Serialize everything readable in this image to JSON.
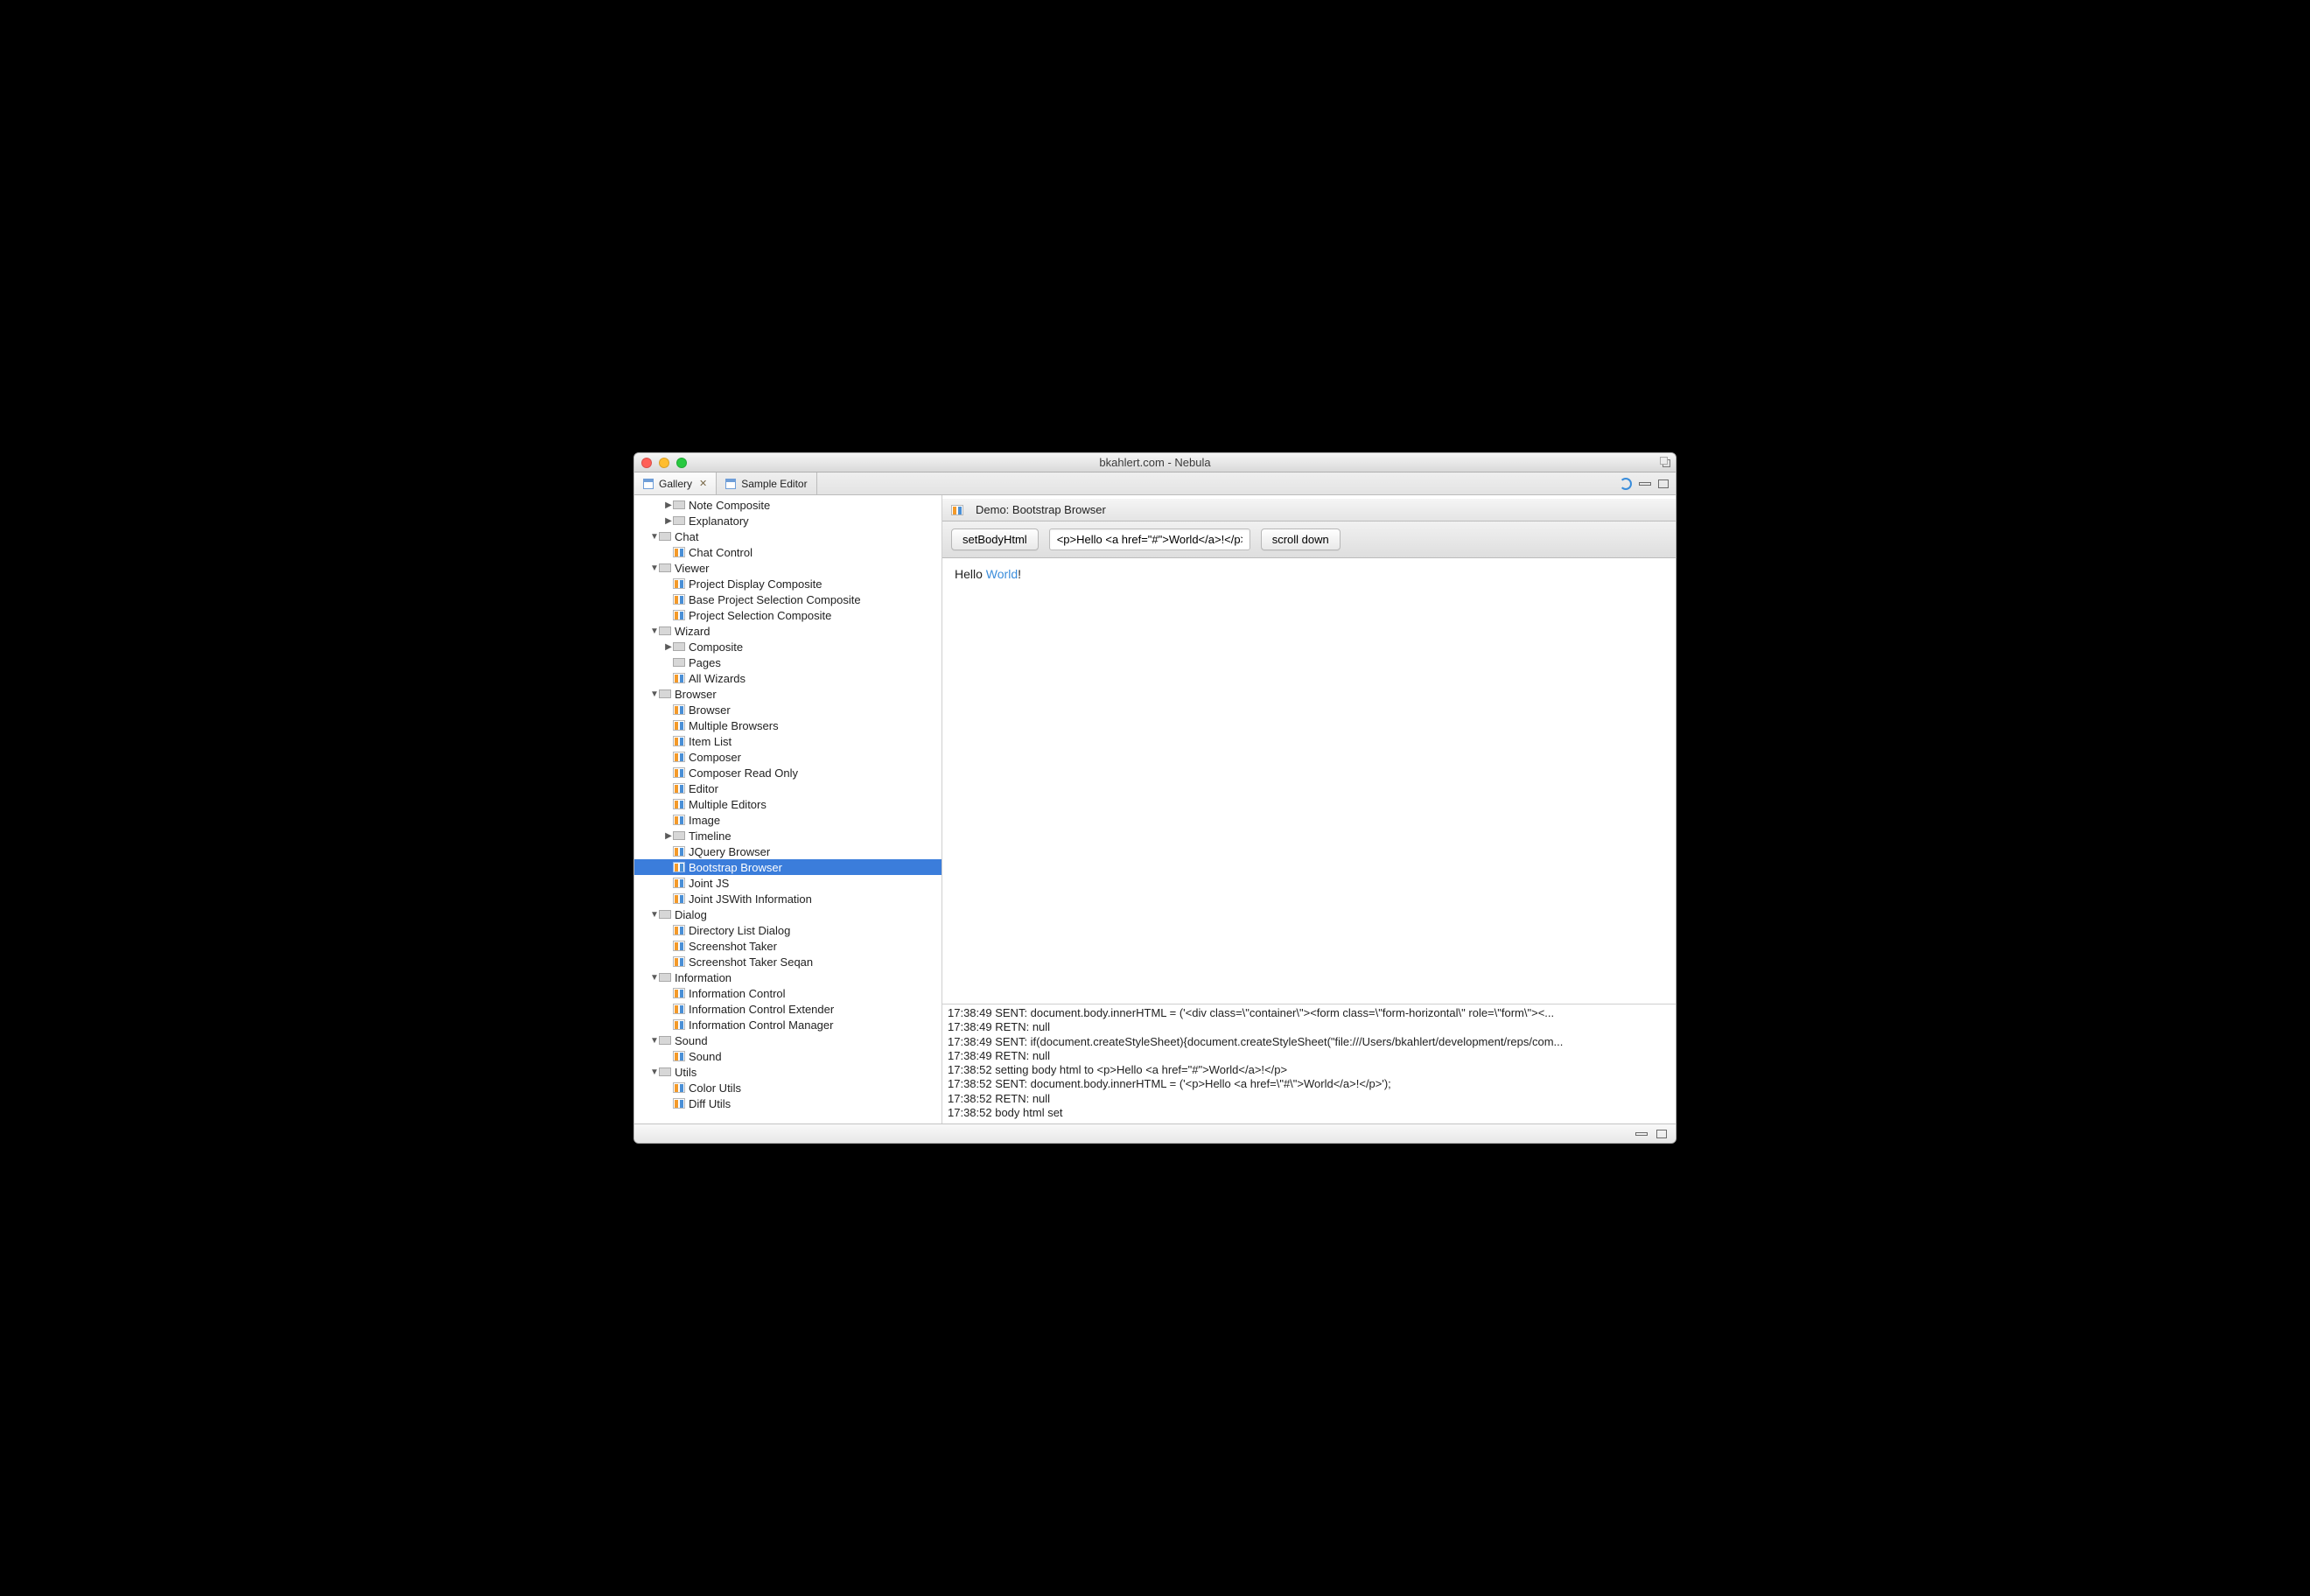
{
  "window": {
    "title": "bkahlert.com - Nebula"
  },
  "tabs": [
    {
      "label": "Gallery",
      "active": true,
      "closable": true
    },
    {
      "label": "Sample Editor",
      "active": false,
      "closable": false
    }
  ],
  "tree": [
    {
      "depth": 1,
      "arrow": "right",
      "icon": "folder",
      "label": "Note Composite"
    },
    {
      "depth": 1,
      "arrow": "right",
      "icon": "folder",
      "label": "Explanatory"
    },
    {
      "depth": 0,
      "arrow": "down",
      "icon": "folder",
      "label": "Chat"
    },
    {
      "depth": 1,
      "arrow": "",
      "icon": "page",
      "label": "Chat Control"
    },
    {
      "depth": 0,
      "arrow": "down",
      "icon": "folder",
      "label": "Viewer"
    },
    {
      "depth": 1,
      "arrow": "",
      "icon": "page",
      "label": "Project Display Composite"
    },
    {
      "depth": 1,
      "arrow": "",
      "icon": "page",
      "label": "Base Project Selection Composite"
    },
    {
      "depth": 1,
      "arrow": "",
      "icon": "page",
      "label": "Project Selection Composite"
    },
    {
      "depth": 0,
      "arrow": "down",
      "icon": "folder",
      "label": "Wizard"
    },
    {
      "depth": 1,
      "arrow": "right",
      "icon": "folder",
      "label": "Composite"
    },
    {
      "depth": 1,
      "arrow": "",
      "icon": "folder",
      "label": "Pages"
    },
    {
      "depth": 1,
      "arrow": "",
      "icon": "page",
      "label": "All Wizards"
    },
    {
      "depth": 0,
      "arrow": "down",
      "icon": "folder",
      "label": "Browser"
    },
    {
      "depth": 1,
      "arrow": "",
      "icon": "page",
      "label": "Browser"
    },
    {
      "depth": 1,
      "arrow": "",
      "icon": "page",
      "label": "Multiple Browsers"
    },
    {
      "depth": 1,
      "arrow": "",
      "icon": "page",
      "label": "Item List"
    },
    {
      "depth": 1,
      "arrow": "",
      "icon": "page",
      "label": "Composer"
    },
    {
      "depth": 1,
      "arrow": "",
      "icon": "page",
      "label": "Composer Read Only"
    },
    {
      "depth": 1,
      "arrow": "",
      "icon": "page",
      "label": "Editor"
    },
    {
      "depth": 1,
      "arrow": "",
      "icon": "page",
      "label": "Multiple Editors"
    },
    {
      "depth": 1,
      "arrow": "",
      "icon": "page",
      "label": "Image"
    },
    {
      "depth": 1,
      "arrow": "right",
      "icon": "folder",
      "label": "Timeline"
    },
    {
      "depth": 1,
      "arrow": "",
      "icon": "page",
      "label": "JQuery Browser"
    },
    {
      "depth": 1,
      "arrow": "",
      "icon": "page",
      "label": "Bootstrap Browser",
      "selected": true
    },
    {
      "depth": 1,
      "arrow": "",
      "icon": "page",
      "label": "Joint JS"
    },
    {
      "depth": 1,
      "arrow": "",
      "icon": "page",
      "label": "Joint JSWith Information"
    },
    {
      "depth": 0,
      "arrow": "down",
      "icon": "folder",
      "label": "Dialog"
    },
    {
      "depth": 1,
      "arrow": "",
      "icon": "page",
      "label": "Directory List Dialog"
    },
    {
      "depth": 1,
      "arrow": "",
      "icon": "page",
      "label": "Screenshot Taker"
    },
    {
      "depth": 1,
      "arrow": "",
      "icon": "page",
      "label": "Screenshot Taker Seqan"
    },
    {
      "depth": 0,
      "arrow": "down",
      "icon": "folder",
      "label": "Information"
    },
    {
      "depth": 1,
      "arrow": "",
      "icon": "page",
      "label": "Information Control"
    },
    {
      "depth": 1,
      "arrow": "",
      "icon": "page",
      "label": "Information Control Extender"
    },
    {
      "depth": 1,
      "arrow": "",
      "icon": "page",
      "label": "Information Control Manager"
    },
    {
      "depth": 0,
      "arrow": "down",
      "icon": "folder",
      "label": "Sound"
    },
    {
      "depth": 1,
      "arrow": "",
      "icon": "page",
      "label": "Sound"
    },
    {
      "depth": 0,
      "arrow": "down",
      "icon": "folder",
      "label": "Utils"
    },
    {
      "depth": 1,
      "arrow": "",
      "icon": "page",
      "label": "Color Utils"
    },
    {
      "depth": 1,
      "arrow": "",
      "icon": "page",
      "label": "Diff Utils"
    }
  ],
  "main": {
    "title": "Demo: Bootstrap Browser",
    "btn_set": "setBodyHtml",
    "input_value": "<p>Hello <a href=\"#\">World</a>!</p>",
    "btn_scroll": "scroll down",
    "viewer_text": "Hello ",
    "viewer_link": "World",
    "viewer_after": "!"
  },
  "log": [
    "17:38:49 SENT: document.body.innerHTML = ('<div class=\\\"container\\\"><form class=\\\"form-horizontal\\\" role=\\\"form\\\"><...",
    "17:38:49 RETN: null",
    "17:38:49 SENT: if(document.createStyleSheet){document.createStyleSheet(\"file:///Users/bkahlert/development/reps/com...",
    "17:38:49 RETN: null",
    "17:38:52 setting body html to <p>Hello <a href=\"#\">World</a>!</p>",
    "17:38:52 SENT: document.body.innerHTML = ('<p>Hello <a href=\\\"#\\\">World</a>!</p>');",
    "17:38:52 RETN: null",
    "17:38:52 body html set"
  ]
}
